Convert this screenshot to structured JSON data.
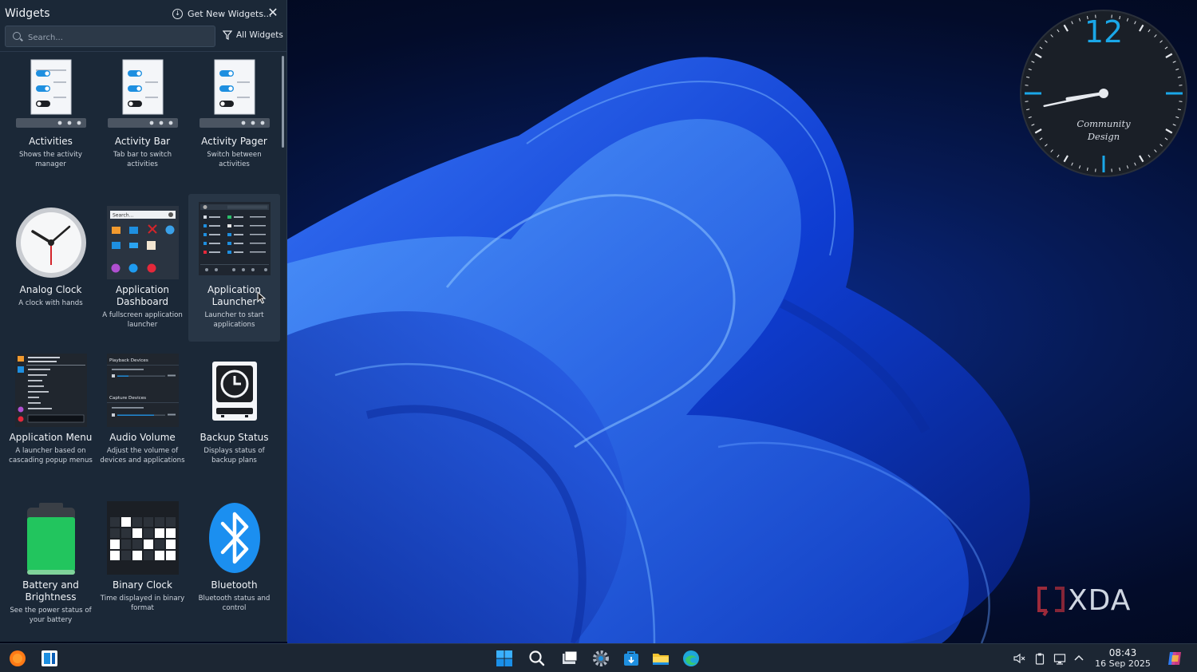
{
  "panel": {
    "title": "Widgets",
    "get_new_label": "Get New Widgets...",
    "search_placeholder": "Search...",
    "filter_label": "All Widgets"
  },
  "widgets": [
    {
      "name": "Activities",
      "desc": "Shows the activity manager",
      "icon": "toggles-icon"
    },
    {
      "name": "Activity Bar",
      "desc": "Tab bar to switch activities",
      "icon": "toggles-icon"
    },
    {
      "name": "Activity Pager",
      "desc": "Switch between activities",
      "icon": "toggles-icon"
    },
    {
      "name": "Analog Clock",
      "desc": "A clock with hands",
      "icon": "analog-clock-icon"
    },
    {
      "name": "Application Dashboard",
      "desc": "A fullscreen application launcher",
      "icon": "dashboard-preview"
    },
    {
      "name": "Application Launcher",
      "desc": "Launcher to start applications",
      "icon": "launcher-preview"
    },
    {
      "name": "Application Menu",
      "desc": "A launcher based on cascading popup menus",
      "icon": "menu-preview"
    },
    {
      "name": "Audio Volume",
      "desc": "Adjust the volume of devices and applications",
      "icon": "audio-preview"
    },
    {
      "name": "Backup Status",
      "desc": "Displays status of backup plans",
      "icon": "backup-icon"
    },
    {
      "name": "Battery and Brightness",
      "desc": "See the power status of your battery",
      "icon": "battery-icon"
    },
    {
      "name": "Binary Clock",
      "desc": "Time displayed in binary format",
      "icon": "binary-clock-icon"
    },
    {
      "name": "Bluetooth",
      "desc": "Bluetooth status and control",
      "icon": "bluetooth-icon"
    }
  ],
  "thumb_text": {
    "dashboard_search": "Search...",
    "audio_playback": "Playback Devices",
    "audio_capture": "Capture Devices"
  },
  "desktop_clock": {
    "top_numeral": "12",
    "label_line1": "Community",
    "label_line2": "Design",
    "hour": 8,
    "minute": 43
  },
  "watermark": "XDA",
  "taskbar": {
    "time": "08:43",
    "date": "16 Sep 2025"
  },
  "colors": {
    "accent": "#1e8fe0",
    "panel_bg": "#1b2837",
    "taskbar_bg": "#1c2633",
    "clock_accent": "#1aa7e8",
    "battery_green": "#22c55e",
    "bluetooth_blue": "#1b8ff0"
  }
}
